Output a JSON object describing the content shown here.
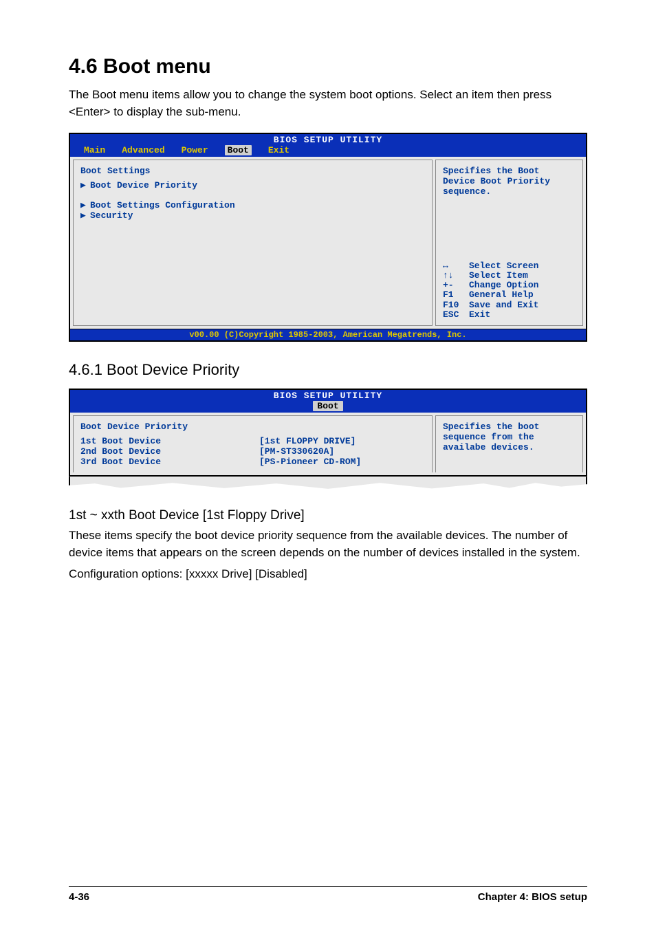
{
  "section": {
    "number_title": "4.6   Boot menu",
    "intro": "The Boot menu items allow you to change the system boot options. Select an item then press <Enter> to display the sub-menu."
  },
  "bios1": {
    "title": "BIOS SETUP UTILITY",
    "tabs": [
      "Main",
      "Advanced",
      "Power",
      "Boot",
      "Exit"
    ],
    "active_tab": "Boot",
    "left": {
      "heading": "Boot Settings",
      "items": [
        "Boot Device Priority",
        "Boot Settings Configuration",
        "Security"
      ]
    },
    "right": {
      "help": "Specifies the Boot Device Boot Priority sequence.",
      "keys": [
        {
          "k": "↔",
          "a": "Select Screen"
        },
        {
          "k": "↑↓",
          "a": "Select Item"
        },
        {
          "k": "+-",
          "a": "Change Option"
        },
        {
          "k": "F1",
          "a": "General Help"
        },
        {
          "k": "F10",
          "a": "Save and Exit"
        },
        {
          "k": "ESC",
          "a": "Exit"
        }
      ]
    },
    "footer": "v00.00 (C)Copyright 1985-2003, American Megatrends, Inc."
  },
  "subsection": {
    "number_title": "4.6.1   Boot Device Priority"
  },
  "bios2": {
    "title": "BIOS SETUP UTILITY",
    "active_tab": "Boot",
    "left": {
      "heading": "Boot Device Priority",
      "rows": [
        {
          "label": "1st Boot Device",
          "value": "[1st FLOPPY DRIVE]"
        },
        {
          "label": "2nd Boot Device",
          "value": "[PM-ST330620A]"
        },
        {
          "label": "3rd Boot Device",
          "value": "[PS-Pioneer CD-ROM]"
        }
      ]
    },
    "right": {
      "help": "Specifies the boot sequence from the availabe devices."
    }
  },
  "item": {
    "title": "1st ~ xxth Boot Device [1st Floppy Drive]",
    "para": "These items specify the boot device priority sequence from the available devices. The number of device items that appears on the screen depends on the number of devices installed in the system.",
    "config": "Configuration options: [xxxxx Drive] [Disabled]"
  },
  "footer": {
    "page": "4-36",
    "chapter": "Chapter 4: BIOS setup"
  }
}
